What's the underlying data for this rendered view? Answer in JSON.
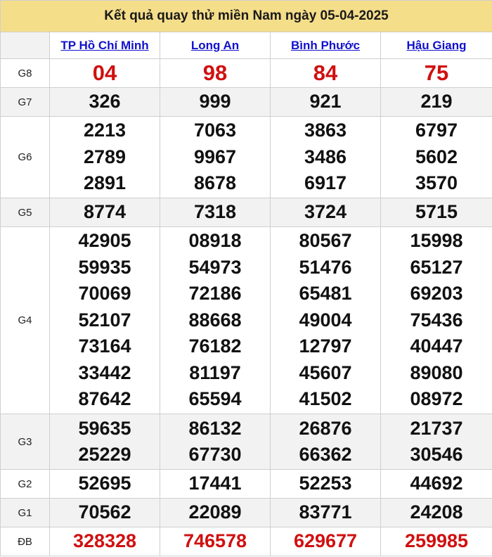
{
  "title": "Kết quả quay thử miền Nam ngày 05-04-2025",
  "provinces": [
    "TP Hồ Chí Minh",
    "Long An",
    "Bình Phước",
    "Hậu Giang"
  ],
  "prizes": {
    "g8": {
      "label": "G8",
      "values": [
        "04",
        "98",
        "84",
        "75"
      ]
    },
    "g7": {
      "label": "G7",
      "values": [
        "326",
        "999",
        "921",
        "219"
      ]
    },
    "g6": {
      "label": "G6",
      "values": [
        [
          "2213",
          "2789",
          "2891"
        ],
        [
          "7063",
          "9967",
          "8678"
        ],
        [
          "3863",
          "3486",
          "6917"
        ],
        [
          "6797",
          "5602",
          "3570"
        ]
      ]
    },
    "g5": {
      "label": "G5",
      "values": [
        "8774",
        "7318",
        "3724",
        "5715"
      ]
    },
    "g4": {
      "label": "G4",
      "values": [
        [
          "42905",
          "59935",
          "70069",
          "52107",
          "73164",
          "33442",
          "87642"
        ],
        [
          "08918",
          "54973",
          "72186",
          "88668",
          "76182",
          "81197",
          "65594"
        ],
        [
          "80567",
          "51476",
          "65481",
          "49004",
          "12797",
          "45607",
          "41502"
        ],
        [
          "15998",
          "65127",
          "69203",
          "75436",
          "40447",
          "89080",
          "08972"
        ]
      ]
    },
    "g3": {
      "label": "G3",
      "values": [
        [
          "59635",
          "25229"
        ],
        [
          "86132",
          "67730"
        ],
        [
          "26876",
          "66362"
        ],
        [
          "21737",
          "30546"
        ]
      ]
    },
    "g2": {
      "label": "G2",
      "values": [
        "52695",
        "17441",
        "52253",
        "44692"
      ]
    },
    "g1": {
      "label": "G1",
      "values": [
        "70562",
        "22089",
        "83771",
        "24208"
      ]
    },
    "db": {
      "label": "ĐB",
      "values": [
        "328328",
        "746578",
        "629677",
        "259985"
      ]
    }
  },
  "colors": {
    "title_bg": "#f5de8a",
    "link": "#1111cc",
    "red": "#d01010",
    "alt_row": "#f2f2f2"
  }
}
